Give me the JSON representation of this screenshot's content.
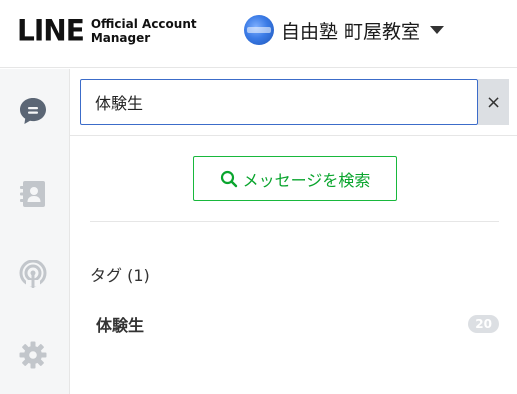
{
  "header": {
    "logo_text": "LINE",
    "logo_sub_1": "Official Account",
    "logo_sub_2": "Manager",
    "account_name": "自由塾 町屋教室"
  },
  "sidebar": {
    "items": [
      {
        "name": "chat",
        "icon": "chat-bubble-icon",
        "active": true
      },
      {
        "name": "contacts",
        "icon": "contact-card-icon",
        "active": false
      },
      {
        "name": "broadcast",
        "icon": "broadcast-icon",
        "active": false
      },
      {
        "name": "settings",
        "icon": "gear-icon",
        "active": false
      }
    ]
  },
  "search": {
    "value": "体験生",
    "clear_label": "×"
  },
  "search_messages_button": {
    "label": "メッセージを検索"
  },
  "tags": {
    "section_title": "タグ (1)",
    "items": [
      {
        "label": "体験生",
        "count": "20"
      }
    ]
  },
  "colors": {
    "accent_green": "#0aa52e",
    "input_border": "#3c6cc9",
    "sidebar_bg": "#f5f6f7",
    "icon_gray": "#c2c6cb",
    "active_icon": "#5b6675"
  }
}
